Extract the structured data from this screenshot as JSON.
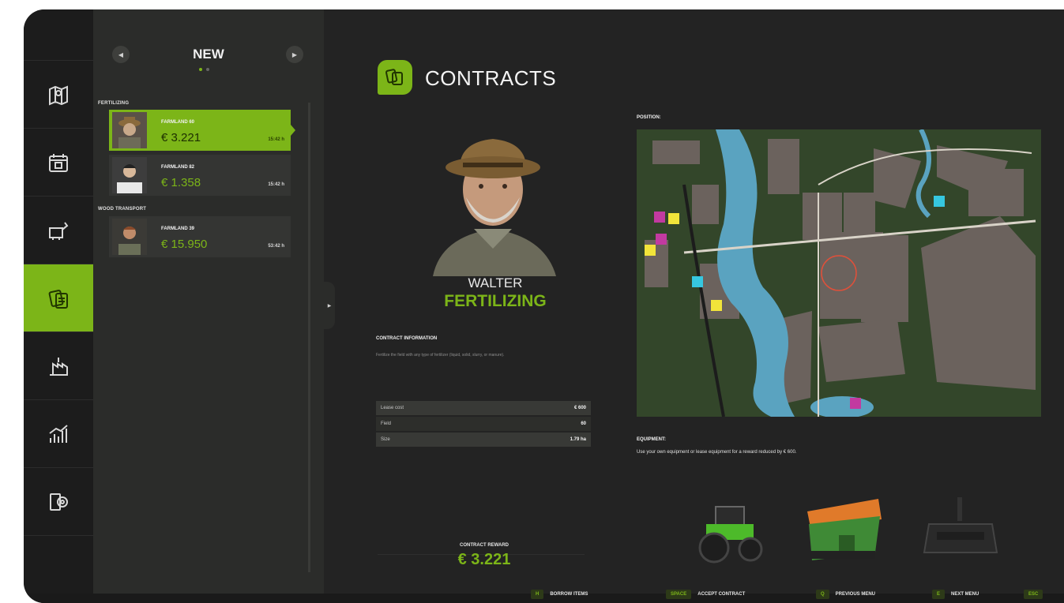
{
  "list": {
    "title": "NEW",
    "categories": [
      {
        "name": "FERTILIZING"
      },
      {
        "name": "WOOD TRANSPORT"
      }
    ],
    "entries": [
      {
        "field": "FARMLAND 60",
        "reward": "€ 3.221",
        "time": "15:42 h"
      },
      {
        "field": "FARMLAND 82",
        "reward": "€ 1.358",
        "time": "15:42 h"
      },
      {
        "field": "FARMLAND 39",
        "reward": "€ 15.950",
        "time": "53:42 h"
      }
    ]
  },
  "main": {
    "title": "CONTRACTS",
    "npc_name": "WALTER",
    "contract_type": "FERTILIZING",
    "info_label": "CONTRACT INFORMATION",
    "description": "Fertilize the field with any type of fertilizer (liquid, solid, slurry, or manure).",
    "details": [
      {
        "key": "Lease cost",
        "value": "€ 600"
      },
      {
        "key": "Field",
        "value": "60"
      },
      {
        "key": "Size",
        "value": "1.79 ha"
      }
    ],
    "reward_label": "CONTRACT REWARD",
    "reward_value": "€ 3.221",
    "position_label": "POSITION:",
    "equipment_label": "EQUIPMENT:",
    "equipment_text": "Use your own equipment or lease equipment for a reward reduced by € 600."
  },
  "footer": {
    "hints": [
      {
        "key": "H",
        "label": "BORROW ITEMS"
      },
      {
        "key": "SPACE",
        "label": "ACCEPT CONTRACT"
      },
      {
        "key": "Q",
        "label": "PREVIOUS MENU"
      },
      {
        "key": "E",
        "label": "NEXT MENU"
      },
      {
        "key": "ESC",
        "label": ""
      }
    ]
  },
  "colors": {
    "accent": "#7cb518",
    "background": "#232323",
    "panel": "#2b2c2a"
  },
  "icons": {
    "rail": [
      "map-icon",
      "calendar-icon",
      "animals-icon",
      "contracts-icon",
      "production-icon",
      "statistics-icon",
      "settings-icon"
    ]
  }
}
